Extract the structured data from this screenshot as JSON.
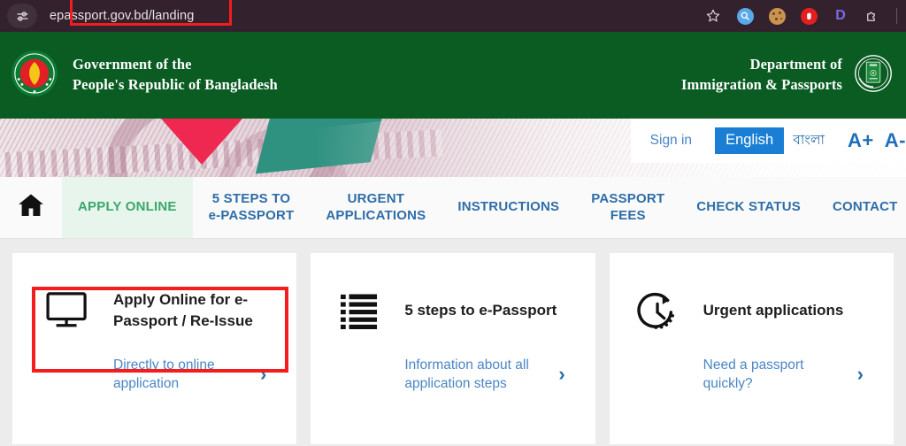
{
  "browser": {
    "url": "epassport.gov.bd/landing",
    "site_info_icon": "site-settings-icon",
    "toolbar_icons": [
      {
        "name": "bookmark-star-icon",
        "glyph": "☆"
      },
      {
        "name": "search-extension-icon",
        "glyph": "⚲"
      },
      {
        "name": "cookie-extension-icon",
        "glyph": "●"
      },
      {
        "name": "adblock-extension-icon",
        "glyph": "✋"
      },
      {
        "name": "dashlane-extension-icon",
        "glyph": "D"
      },
      {
        "name": "extensions-puzzle-icon",
        "glyph": "⬚"
      }
    ],
    "highlight_color": "#f41c1c"
  },
  "header": {
    "emblem_name": "bangladesh-national-emblem",
    "gov_line1": "Government of the",
    "gov_line2": "People's Republic of Bangladesh",
    "dept_line1": "Department of",
    "dept_line2": "Immigration & Passports",
    "dept_logo_name": "immigration-passports-seal",
    "background_color": "#0a5c22"
  },
  "utility": {
    "sign_in": "Sign in",
    "lang_english": "English",
    "lang_bangla": "বাংলা",
    "font_increase": "A+",
    "font_decrease": "A-",
    "active_language": "English",
    "active_color": "#1a7fd4"
  },
  "nav": {
    "home_icon": "home-icon",
    "items": [
      {
        "label": "APPLY ONLINE",
        "active": true
      },
      {
        "label": "5 STEPS TO\ne-PASSPORT",
        "active": false
      },
      {
        "label": "URGENT\nAPPLICATIONS",
        "active": false
      },
      {
        "label": "INSTRUCTIONS",
        "active": false
      },
      {
        "label": "PASSPORT\nFEES",
        "active": false
      },
      {
        "label": "CHECK STATUS",
        "active": false
      },
      {
        "label": "CONTACT",
        "active": false
      }
    ],
    "active_text_color": "#3aa86a",
    "active_bg_color": "#e8f5ed",
    "link_color": "#2e6da8"
  },
  "cards": [
    {
      "icon": "monitor-icon",
      "title": "Apply Online for\ne-Passport / Re-Issue",
      "link": "Directly to online\napplication",
      "chevron": "›",
      "highlighted": true
    },
    {
      "icon": "list-icon",
      "title": "5 steps to e-Passport",
      "link": "Information about all\napplication steps",
      "chevron": "›",
      "highlighted": false
    },
    {
      "icon": "clock-urgent-icon",
      "title": "Urgent applications",
      "link": "Need a passport\nquickly?",
      "chevron": "›",
      "highlighted": false
    }
  ]
}
